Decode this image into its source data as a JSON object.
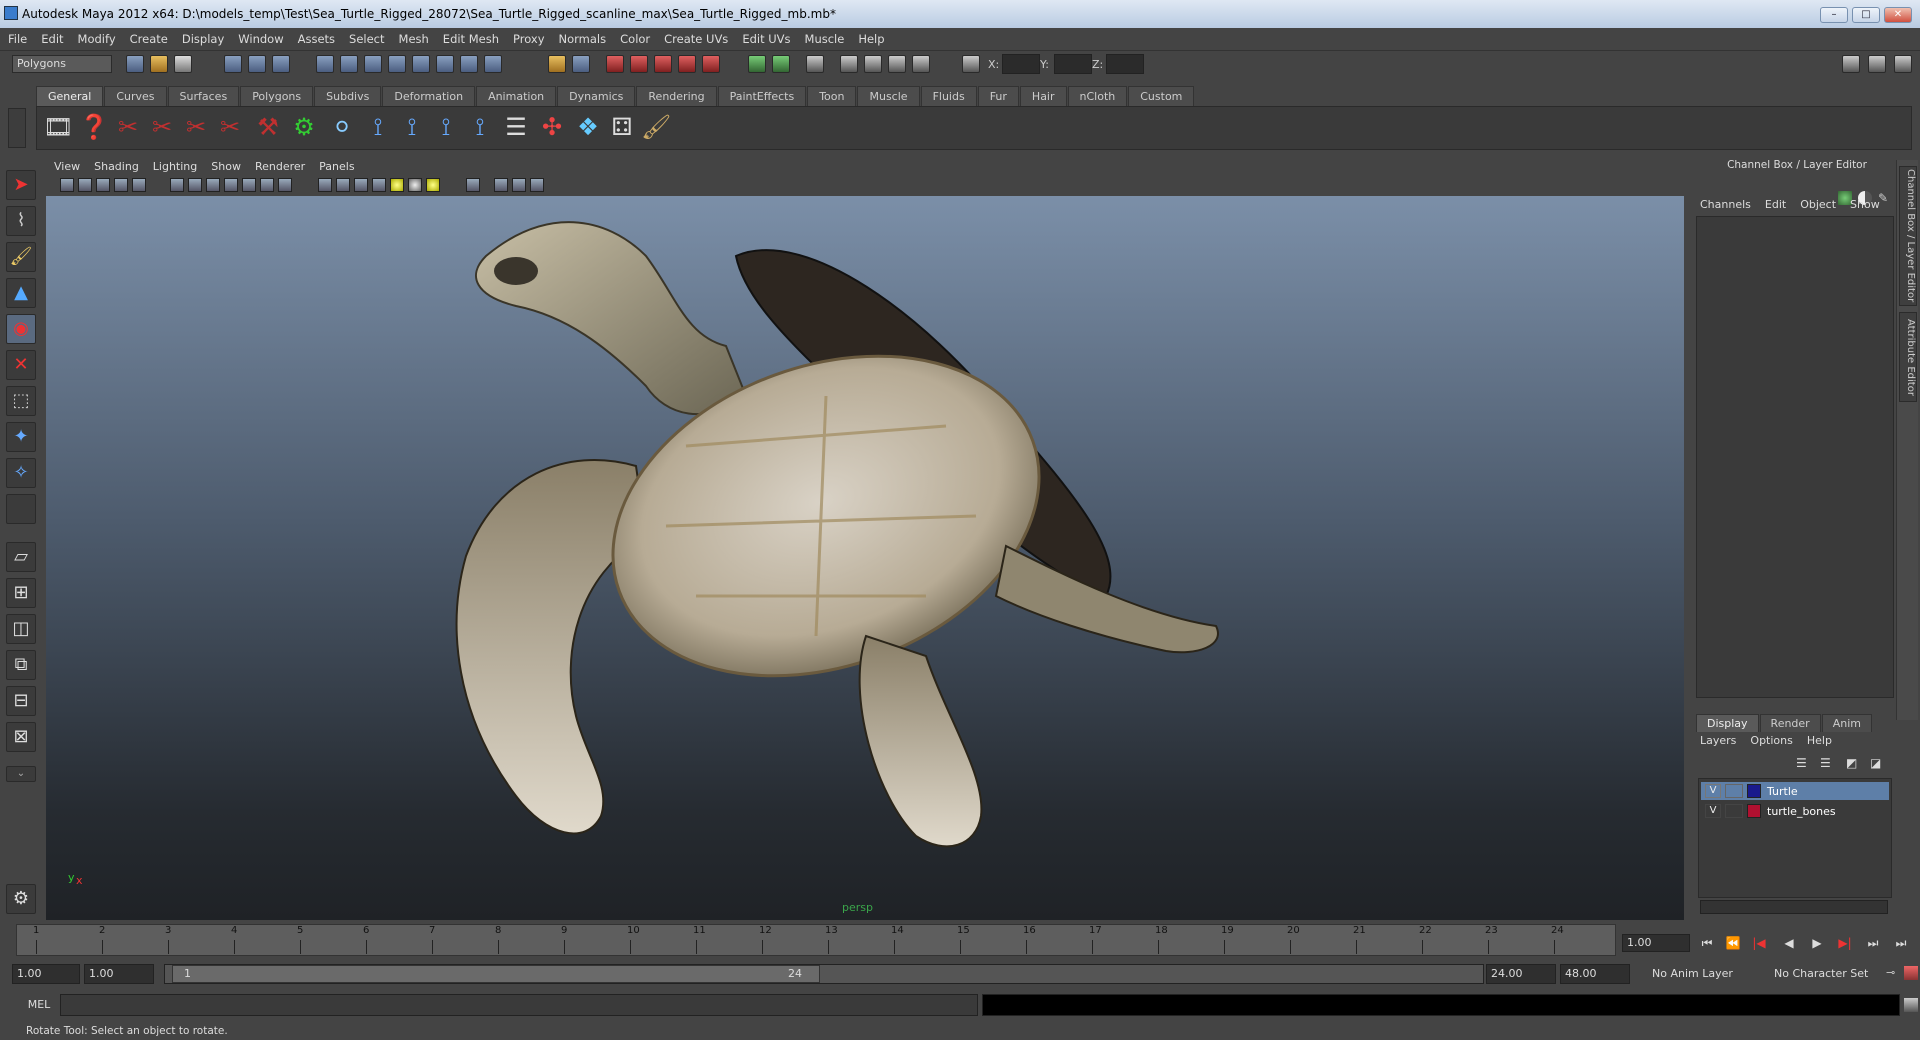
{
  "window": {
    "title": "Autodesk Maya 2012 x64: D:\\models_temp\\Test\\Sea_Turtle_Rigged_28072\\Sea_Turtle_Rigged_scanline_max\\Sea_Turtle_Rigged_mb.mb*",
    "controls": [
      "–",
      "□",
      "✕"
    ]
  },
  "menubar": [
    "File",
    "Edit",
    "Modify",
    "Create",
    "Display",
    "Window",
    "Assets",
    "Select",
    "Mesh",
    "Edit Mesh",
    "Proxy",
    "Normals",
    "Color",
    "Create UVs",
    "Edit UVs",
    "Muscle",
    "Help"
  ],
  "statusline": {
    "mode": "Polygons",
    "x_label": "X:",
    "y_label": "Y:",
    "z_label": "Z:"
  },
  "shelf": {
    "tabs": [
      "General",
      "Curves",
      "Surfaces",
      "Polygons",
      "Subdivs",
      "Deformation",
      "Animation",
      "Dynamics",
      "Rendering",
      "PaintEffects",
      "Toon",
      "Muscle",
      "Fluids",
      "Fur",
      "Hair",
      "nCloth",
      "Custom"
    ],
    "active_tab": "General",
    "icons": [
      "🎞",
      "❓",
      "✂",
      "✂",
      "✂",
      "✂",
      "⚒",
      "⚙",
      "⚪",
      "⟟",
      "⟟",
      "⟟",
      "⟟",
      "☰",
      "✣",
      "❖",
      "⚃",
      "🖌"
    ]
  },
  "panel": {
    "menu": [
      "View",
      "Shading",
      "Lighting",
      "Show",
      "Renderer",
      "Panels"
    ],
    "camera": "persp"
  },
  "channel_box": {
    "title": "Channel Box / Layer Editor",
    "menu": [
      "Channels",
      "Edit",
      "Object",
      "Show"
    ],
    "side_tabs": [
      "Channel Box / Layer Editor",
      "Attribute Editor"
    ]
  },
  "layer_editor": {
    "tabs": [
      "Display",
      "Render",
      "Anim"
    ],
    "active_tab": "Display",
    "menu": [
      "Layers",
      "Options",
      "Help"
    ],
    "layers": [
      {
        "v": "V",
        "name": "Turtle",
        "color": "#1a1a8c",
        "selected": true
      },
      {
        "v": "V",
        "name": "turtle_bones",
        "color": "#b01030",
        "selected": false
      }
    ]
  },
  "timeline": {
    "ticks": [
      "1",
      "2",
      "3",
      "4",
      "5",
      "6",
      "7",
      "8",
      "9",
      "10",
      "11",
      "12",
      "13",
      "14",
      "15",
      "16",
      "17",
      "18",
      "19",
      "20",
      "21",
      "22",
      "23",
      "24"
    ],
    "current_frame": "1.00",
    "playback": [
      "⏮",
      "⏪",
      "|◀",
      "◀",
      "▶",
      "▶|",
      "⏭",
      "⏭"
    ]
  },
  "range": {
    "start": "1.00",
    "inner_start": "1.00",
    "handle_start": "1",
    "handle_end": "24",
    "end": "24.00",
    "outer_end": "48.00",
    "anim_layer": "No Anim Layer",
    "char_set": "No Character Set"
  },
  "command": {
    "label": "MEL",
    "value": ""
  },
  "helpline": "Rotate Tool: Select an object to rotate."
}
